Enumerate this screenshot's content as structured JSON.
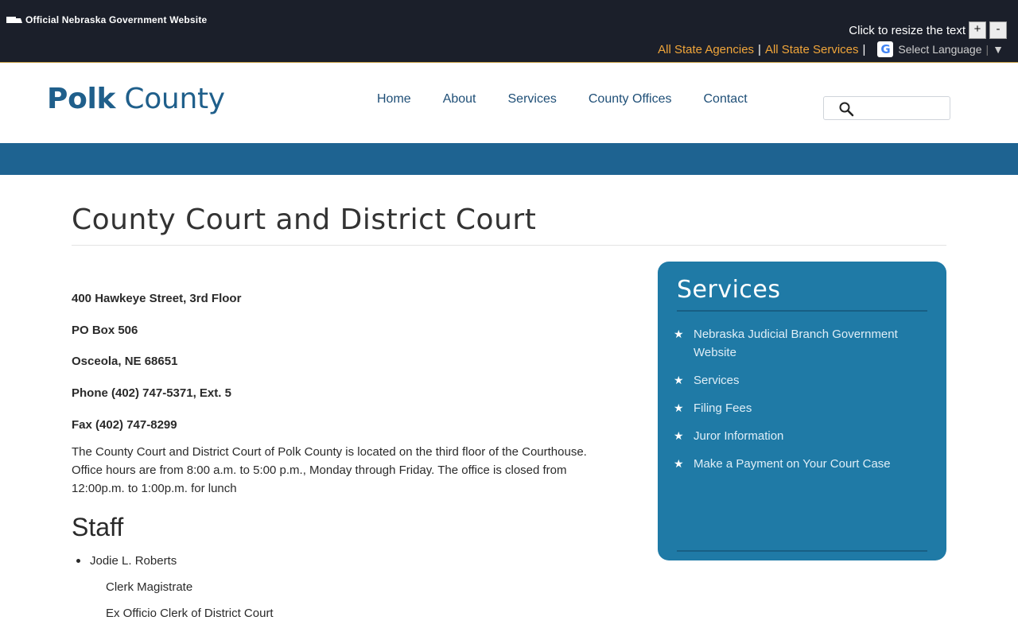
{
  "statebar": {
    "official_label": "Official Nebraska Government Website",
    "resize_label": "Click to resize the text",
    "resize_plus": "+",
    "resize_minus": "-",
    "agencies_link": "All State Agencies",
    "services_link": "All State Services",
    "separator": "|",
    "translate_label": "Select Language",
    "translate_arrow": "▼"
  },
  "header": {
    "logo_bold": "Polk",
    "logo_light": "County",
    "nav": [
      "Home",
      "About",
      "Services",
      "County Offices",
      "Contact"
    ],
    "search_placeholder": ""
  },
  "main": {
    "title": "County Court and District Court",
    "contact": [
      "400 Hawkeye Street, 3rd Floor",
      "PO Box 506",
      "Osceola, NE 68651",
      "Phone  (402) 747-5371, Ext. 5",
      "Fax  (402) 747-8299"
    ],
    "description": "The County Court and District Court of Polk County is located on the third floor of the Courthouse. Office hours are from 8:00 a.m. to 5:00 p.m., Monday through Friday. The office is closed from 12:00p.m. to 1:00p.m. for lunch",
    "staff_heading": "Staff",
    "staff": [
      {
        "name": "Jodie L. Roberts",
        "titles": [
          "Clerk Magistrate",
          "Ex Officio Clerk of District Court"
        ]
      }
    ]
  },
  "sidebar": {
    "title": "Services",
    "items": [
      "Nebraska Judicial Branch Government Website",
      "Services",
      "Filing Fees",
      "Juror Information",
      "Make a Payment on Your Court Case"
    ]
  },
  "colors": {
    "state_bar": "#1b1f2a",
    "link_orange": "#f0a53a",
    "brand_blue": "#1f5f8b",
    "band_blue": "#1e6391",
    "services_box": "#1f7aa6"
  }
}
